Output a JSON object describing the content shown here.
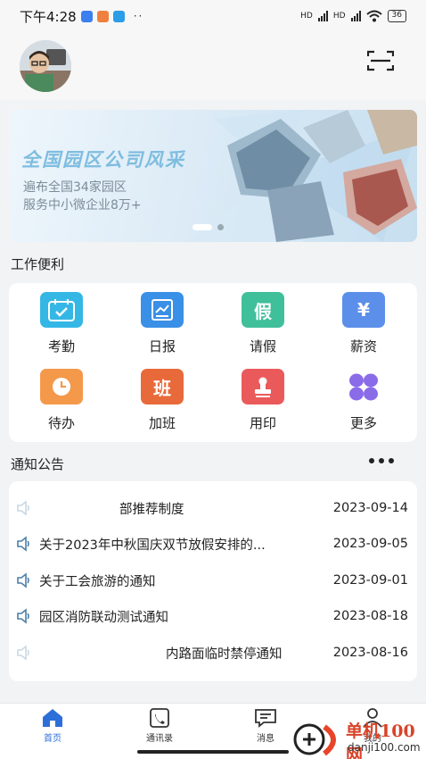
{
  "status_bar": {
    "time": "下午4:28",
    "battery": "36",
    "net_label_1": "HD",
    "net_label_2": "HD"
  },
  "banner": {
    "title": "全国园区公司风采",
    "sub1": "遍布全国34家园区",
    "sub2": "服务中小微企业8万+"
  },
  "sections": {
    "tools_title": "工作便利",
    "notices_title": "通知公告"
  },
  "tools": [
    {
      "label": "考勤",
      "icon": "calendar-check-icon",
      "color": "#35b7e6"
    },
    {
      "label": "日报",
      "icon": "report-icon",
      "color": "#3a8fe6"
    },
    {
      "label": "请假",
      "icon": "leave-icon",
      "glyph": "假",
      "color": "#3fbf9a"
    },
    {
      "label": "薪资",
      "icon": "salary-icon",
      "glyph": "¥",
      "color": "#5b8fea"
    },
    {
      "label": "待办",
      "icon": "clock-icon",
      "color": "#f4994a"
    },
    {
      "label": "加班",
      "icon": "overtime-icon",
      "glyph": "班",
      "color": "#e86a3a"
    },
    {
      "label": "用印",
      "icon": "seal-icon",
      "color": "#ea5a5a"
    },
    {
      "label": "更多",
      "icon": "more-grid-icon",
      "color": "#8a6be8"
    }
  ],
  "notices": [
    {
      "title": "部推荐制度",
      "date": "2023-09-14"
    },
    {
      "title": "关于2023年中秋国庆双节放假安排的...",
      "date": "2023-09-05"
    },
    {
      "title": "关于工会旅游的通知",
      "date": "2023-09-01"
    },
    {
      "title": "园区消防联动测试通知",
      "date": "2023-08-18"
    },
    {
      "title": "内路面临时禁停通知",
      "date": "2023-08-16"
    }
  ],
  "nav": [
    {
      "label": "首页",
      "icon": "home-icon",
      "active": true
    },
    {
      "label": "通讯录",
      "icon": "contacts-icon",
      "active": false
    },
    {
      "label": "消息",
      "icon": "message-icon",
      "active": false
    },
    {
      "label": "我的",
      "icon": "profile-icon",
      "active": false
    }
  ],
  "watermark": {
    "text1": "单机100网",
    "text2": "danji100.com"
  },
  "colors": {
    "accent": "#2d6fd8",
    "background": "#f2f3f5"
  }
}
